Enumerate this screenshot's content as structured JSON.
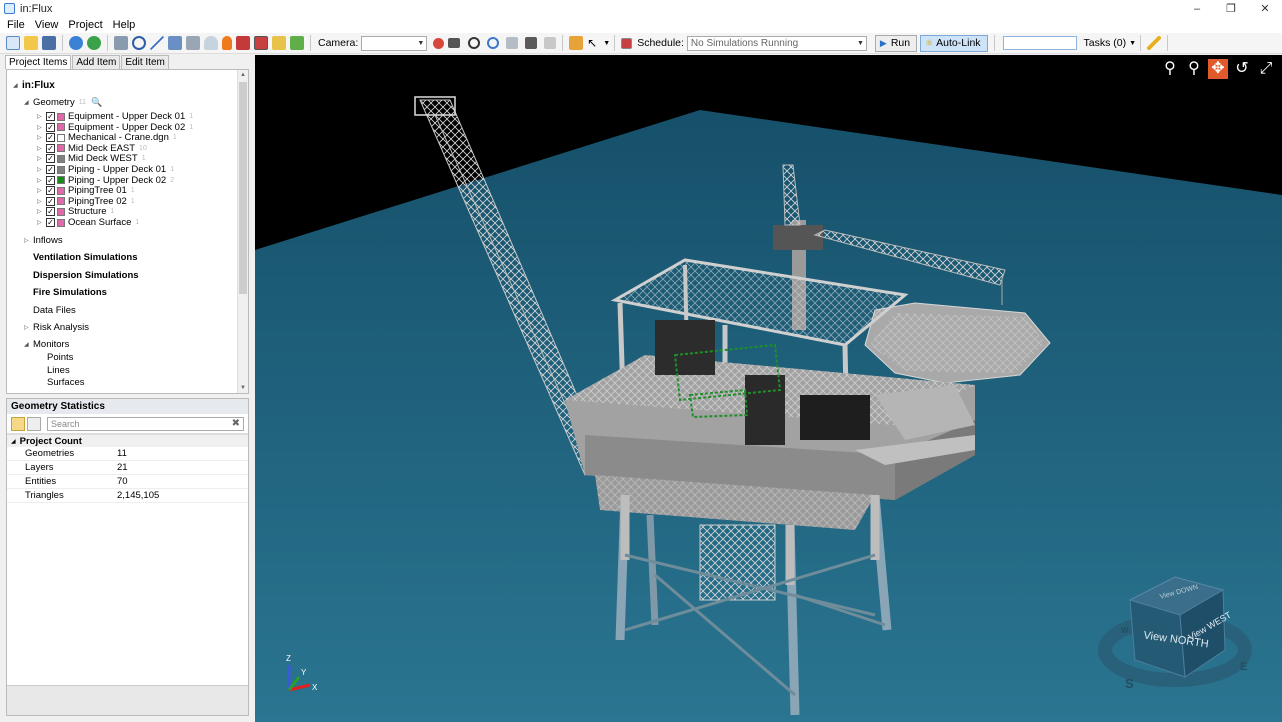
{
  "window": {
    "title": "in:Flux"
  },
  "menu": [
    "File",
    "View",
    "Project",
    "Help"
  ],
  "toolbar": {
    "camera_label": "Camera:",
    "camera_value": "",
    "schedule_label": "Schedule:",
    "schedule_value": "No Simulations Running",
    "run_label": "Run",
    "autolink_label": "Auto-Link",
    "tasks_label": "Tasks (0)"
  },
  "left_tabs": [
    "Project Items",
    "Add Item",
    "Edit Item"
  ],
  "tree": {
    "root": "in:Flux",
    "geometry": {
      "label": "Geometry",
      "count": "11"
    },
    "items": [
      {
        "label": "Equipment - Upper Deck 01",
        "count": "1",
        "color": "#e06aa8",
        "checked": true
      },
      {
        "label": "Equipment - Upper Deck 02",
        "count": "1",
        "color": "#e06aa8",
        "checked": true
      },
      {
        "label": "Mechanical - Crane.dgn",
        "count": "1",
        "color": "#ffffff",
        "checked": true
      },
      {
        "label": "Mid Deck EAST",
        "count": "10",
        "color": "#e06aa8",
        "checked": true
      },
      {
        "label": "Mid Deck WEST",
        "count": "1",
        "color": "#808080",
        "checked": true
      },
      {
        "label": "Piping - Upper Deck 01",
        "count": "1",
        "color": "#808080",
        "checked": true
      },
      {
        "label": "Piping - Upper Deck 02",
        "count": "2",
        "color": "#1a8a1a",
        "checked": true
      },
      {
        "label": "PipingTree 01",
        "count": "1",
        "color": "#e06aa8",
        "checked": true
      },
      {
        "label": "PipingTree 02",
        "count": "1",
        "color": "#e06aa8",
        "checked": true
      },
      {
        "label": "Structure",
        "count": "1",
        "color": "#e06aa8",
        "checked": true
      },
      {
        "label": "Ocean Surface",
        "count": "1",
        "color": "#e06aa8",
        "checked": true
      }
    ],
    "sections": {
      "inflows": "Inflows",
      "ventilation": "Ventilation Simulations",
      "dispersion": "Dispersion Simulations",
      "fire": "Fire Simulations",
      "data_files": "Data Files",
      "risk": "Risk Analysis",
      "monitors": "Monitors",
      "points": "Points",
      "lines": "Lines",
      "surfaces": "Surfaces"
    }
  },
  "stats": {
    "title": "Geometry Statistics",
    "search_placeholder": "Search",
    "group": "Project Count",
    "rows": [
      {
        "name": "Geometries",
        "value": "11"
      },
      {
        "name": "Layers",
        "value": "21"
      },
      {
        "name": "Entities",
        "value": "70"
      },
      {
        "name": "Triangles",
        "value": "2,145,105"
      }
    ]
  },
  "viewcube": {
    "face_front": "View NORTH",
    "face_side": "View WEST",
    "face_top": "View DOWN",
    "compass": [
      "S",
      "E",
      "W"
    ]
  },
  "axes": {
    "z": "Z",
    "y": "Y",
    "x": "X"
  },
  "colors": {
    "ocean": "#1f6a87",
    "sky": "#000000",
    "accent": "#e05a2b"
  }
}
